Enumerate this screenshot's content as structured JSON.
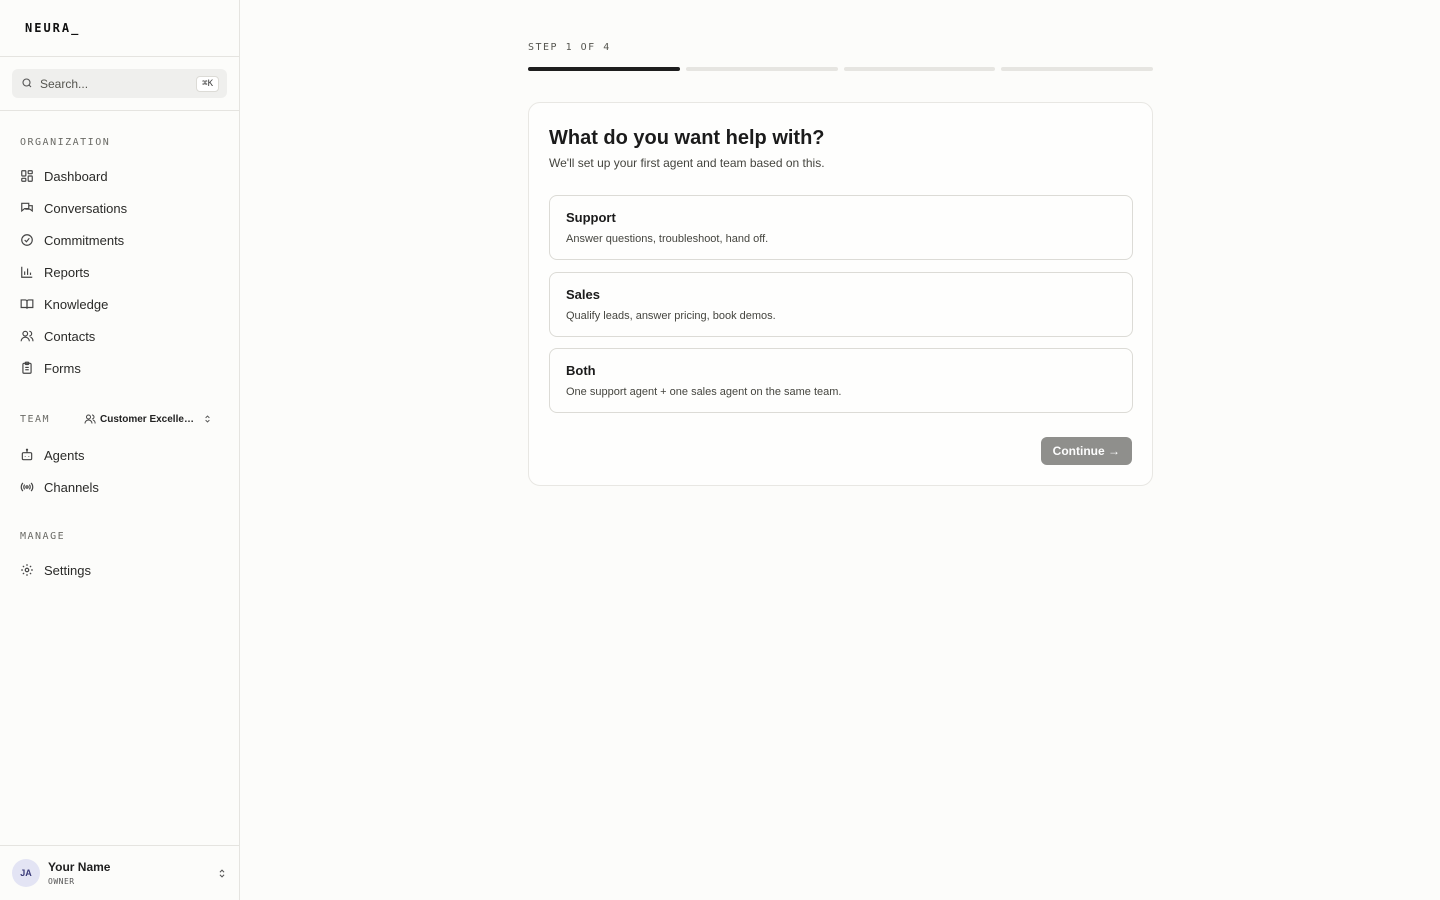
{
  "brand": {
    "name": "NEURA_"
  },
  "search": {
    "placeholder": "Search...",
    "shortcut": "⌘K"
  },
  "sidebar": {
    "organization": {
      "label": "ORGANIZATION",
      "items": [
        {
          "label": "Dashboard",
          "icon": "dashboard-icon"
        },
        {
          "label": "Conversations",
          "icon": "conversations-icon"
        },
        {
          "label": "Commitments",
          "icon": "check-circle-icon"
        },
        {
          "label": "Reports",
          "icon": "bar-chart-icon"
        },
        {
          "label": "Knowledge",
          "icon": "book-icon"
        },
        {
          "label": "Contacts",
          "icon": "users-icon"
        },
        {
          "label": "Forms",
          "icon": "clipboard-icon"
        }
      ]
    },
    "team": {
      "label": "TEAM",
      "selected": "Customer Excellence",
      "items": [
        {
          "label": "Agents",
          "icon": "bot-icon"
        },
        {
          "label": "Channels",
          "icon": "broadcast-icon"
        }
      ]
    },
    "manage": {
      "label": "MANAGE",
      "items": [
        {
          "label": "Settings",
          "icon": "gear-icon"
        }
      ]
    }
  },
  "user": {
    "initials": "JA",
    "name": "Your Name",
    "role": "OWNER"
  },
  "onboarding": {
    "step_label": "STEP 1 OF 4",
    "current_step": 1,
    "total_steps": 4,
    "title": "What do you want help with?",
    "subtitle": "We'll set up your first agent and team based on this.",
    "options": [
      {
        "title": "Support",
        "description": "Answer questions, troubleshoot, hand off."
      },
      {
        "title": "Sales",
        "description": "Qualify leads, answer pricing, book demos."
      },
      {
        "title": "Both",
        "description": "One support agent + one sales agent on the same team."
      }
    ],
    "continue_label": "Continue →"
  },
  "colors": {
    "accent": "#1e1e1e",
    "disabled_button": "#8f8f8c",
    "background": "#fcfcfa"
  }
}
